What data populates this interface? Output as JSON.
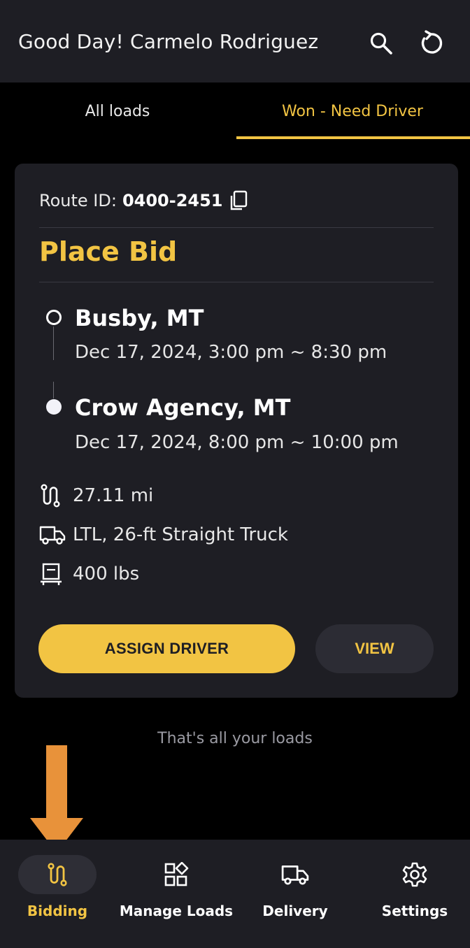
{
  "header": {
    "greeting": "Good Day! Carmelo Rodriguez",
    "search_icon": "search-icon",
    "refresh_icon": "refresh-icon"
  },
  "tabs": [
    {
      "label": "All loads",
      "active": false
    },
    {
      "label": "Won - Need Driver",
      "active": true
    }
  ],
  "card": {
    "route_label": "Route ID:",
    "route_id": "0400-2451",
    "status": "Place Bid",
    "origin": {
      "city": "Busby, MT",
      "time": "Dec 17, 2024, 3:00 pm ~ 8:30 pm"
    },
    "destination": {
      "city": "Crow Agency, MT",
      "time": "Dec 17, 2024, 8:00 pm ~ 10:00 pm"
    },
    "distance": "27.11 mi",
    "equipment": "LTL, 26-ft Straight Truck",
    "weight": "400 lbs",
    "assign_label": "ASSIGN DRIVER",
    "view_label": "VIEW"
  },
  "footer_text": "That's all your loads",
  "nav": [
    {
      "label": "Bidding",
      "icon": "route-icon",
      "active": true
    },
    {
      "label": "Manage Loads",
      "icon": "grid-shapes-icon",
      "active": false
    },
    {
      "label": "Delivery",
      "icon": "truck-icon",
      "active": false
    },
    {
      "label": "Settings",
      "icon": "gear-icon",
      "active": false
    }
  ],
  "colors": {
    "accent": "#f2c443",
    "surface": "#1e1e24",
    "background": "#000000",
    "annotation_arrow": "#e8923a"
  }
}
